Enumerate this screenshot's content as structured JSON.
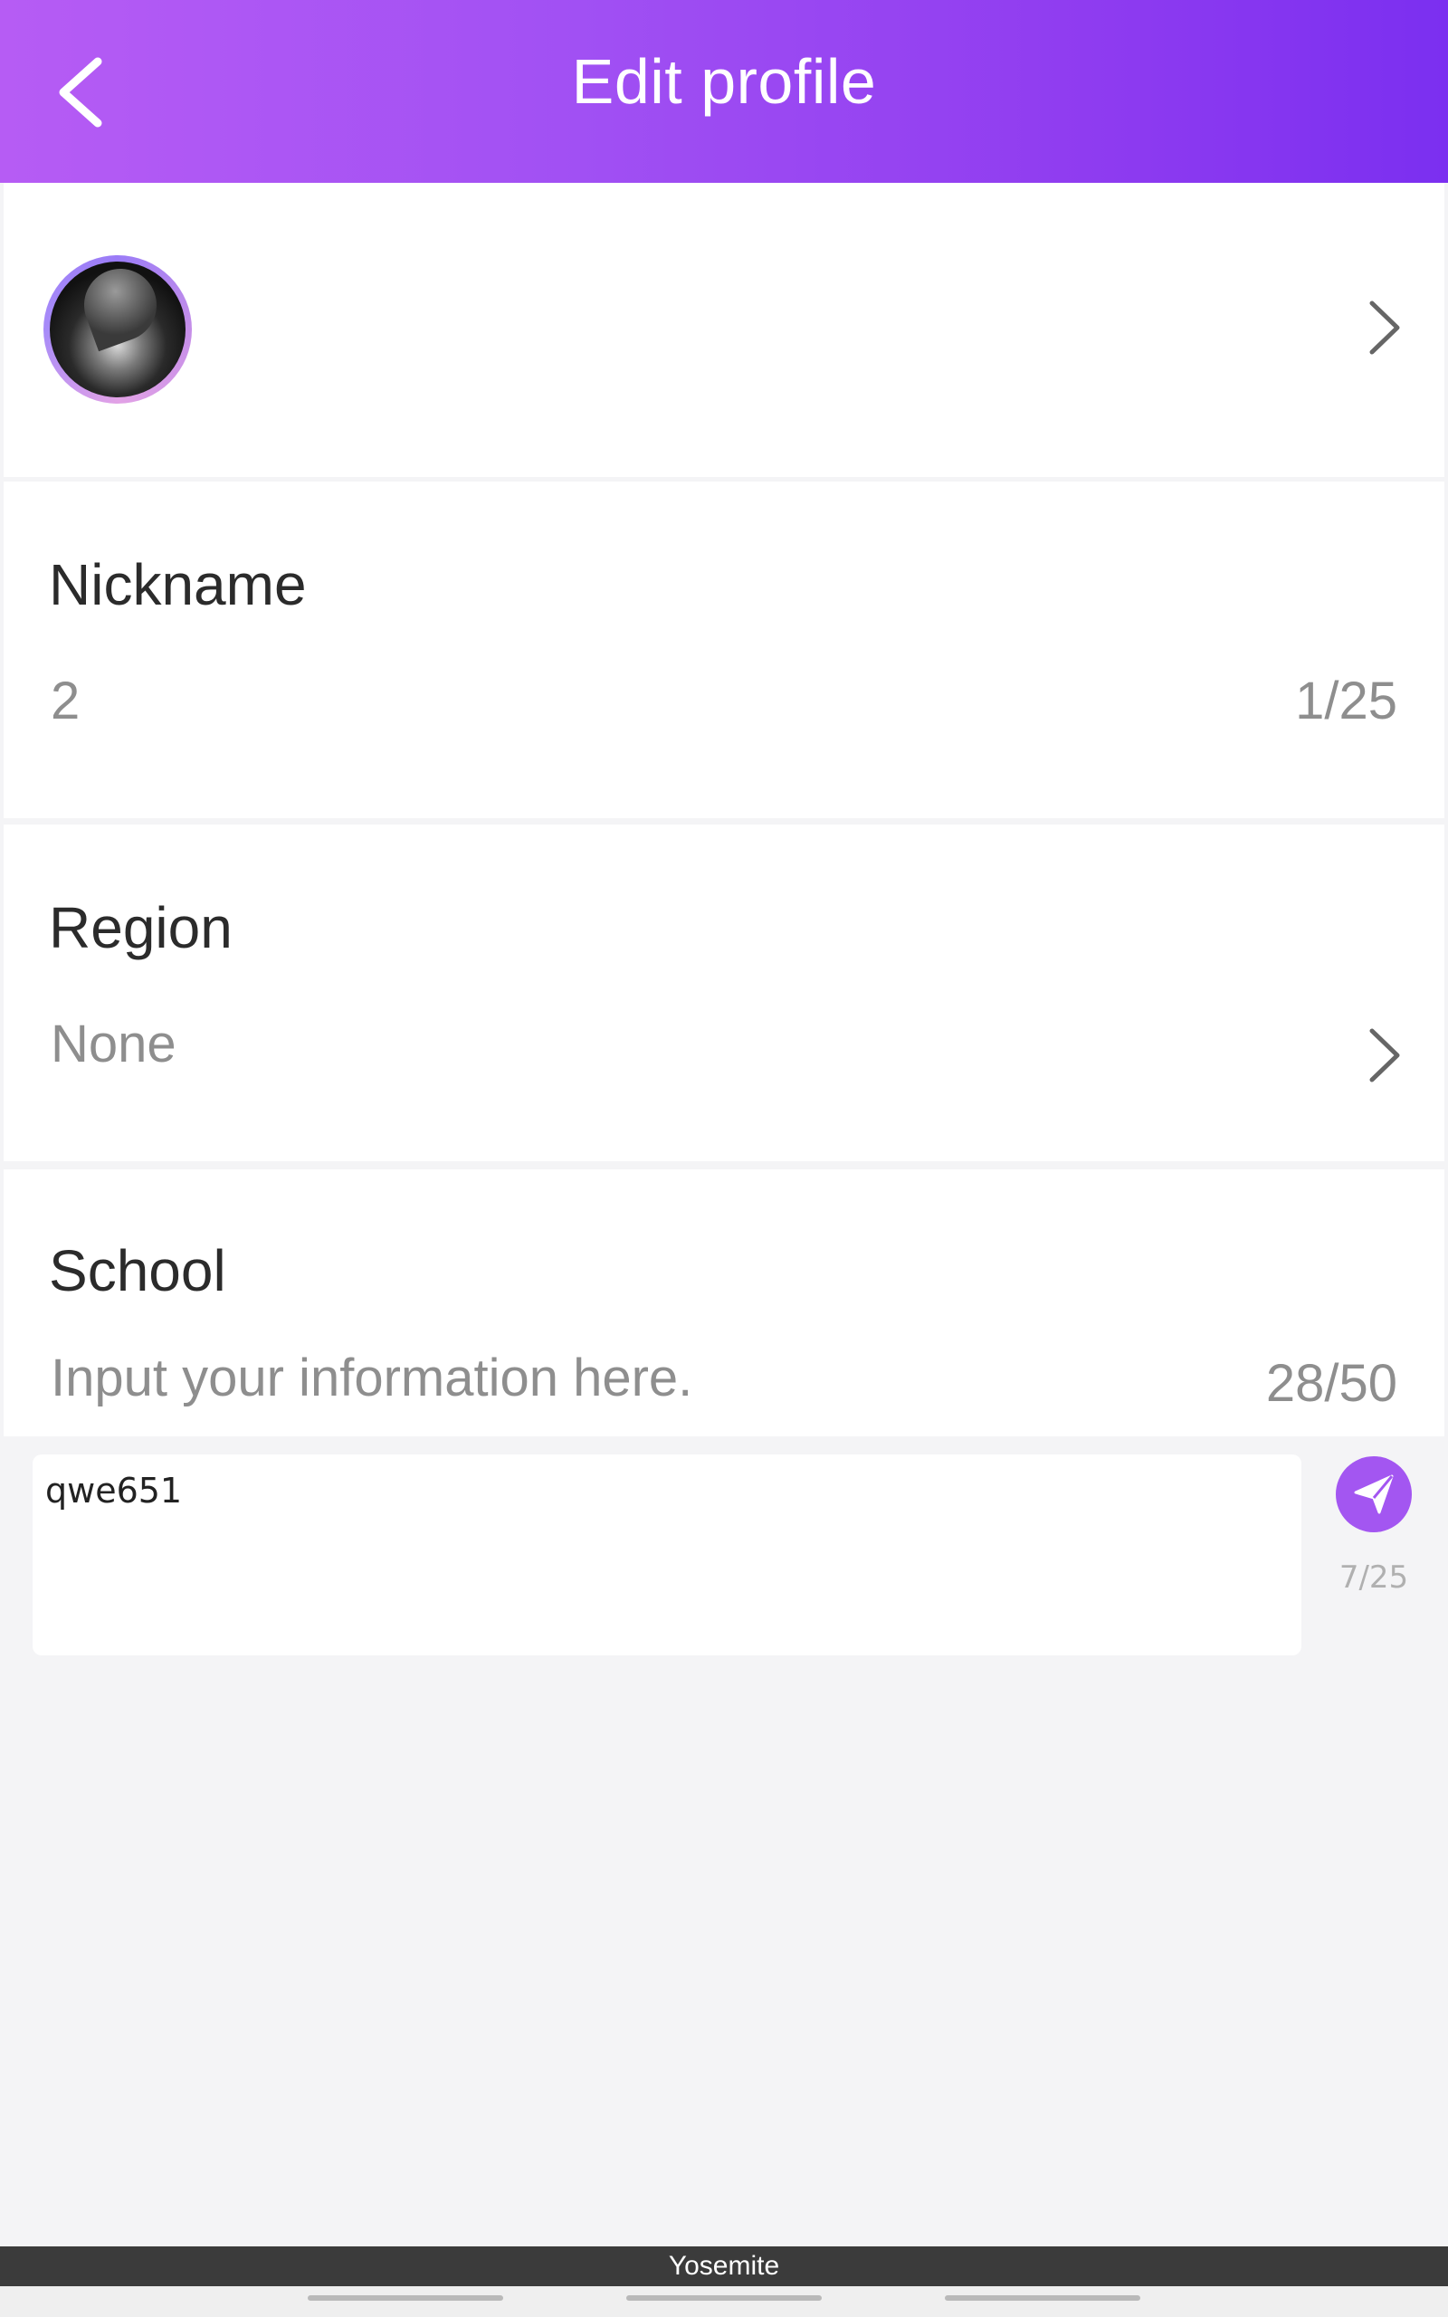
{
  "header": {
    "title": "Edit profile",
    "back_icon": "chevron-left-icon"
  },
  "avatar_row": {
    "chevron_icon": "chevron-right-icon"
  },
  "nickname": {
    "label": "Nickname",
    "value": "2",
    "counter": "1/25"
  },
  "region": {
    "label": "Region",
    "value": "None",
    "chevron_icon": "chevron-right-icon"
  },
  "school": {
    "label": "School",
    "placeholder": "Input your information here.",
    "counter": "28/50"
  },
  "input_panel": {
    "text": "qwe651",
    "counter": "7/25",
    "send_icon": "send-icon"
  },
  "bottom_bar": {
    "label": "Yosemite"
  },
  "colors": {
    "header_start": "#b65cf4",
    "header_end": "#7b2ff0",
    "accent": "#a356f1"
  }
}
